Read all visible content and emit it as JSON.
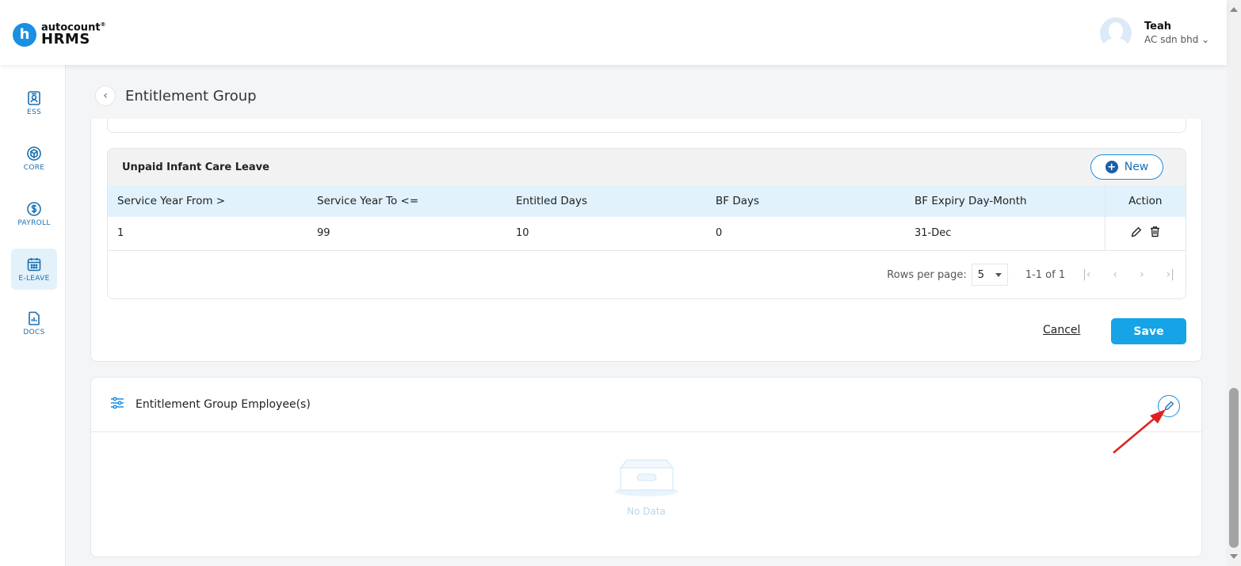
{
  "app": {
    "logo_letter": "h",
    "logo_top": "autocount",
    "logo_mark": "®",
    "logo_bottom": "HRMS",
    "brand_color": "#1a8fe3"
  },
  "user": {
    "name": "Teah",
    "company": "AC sdn bhd"
  },
  "sidebar": {
    "items": [
      {
        "label": "ESS",
        "icon": "ess-icon",
        "active": false
      },
      {
        "label": "CORE",
        "icon": "core-icon",
        "active": false
      },
      {
        "label": "PAYROLL",
        "icon": "payroll-icon",
        "active": false
      },
      {
        "label": "E-LEAVE",
        "icon": "calendar-icon",
        "active": true
      },
      {
        "label": "DOCS",
        "icon": "docs-icon",
        "active": false
      }
    ]
  },
  "page": {
    "title": "Entitlement Group"
  },
  "leave_section": {
    "title": "Unpaid Infant Care Leave",
    "new_label": "New",
    "columns": [
      "Service Year From >",
      "Service Year To <=",
      "Entitled Days",
      "BF Days",
      "BF Expiry Day-Month",
      "Action"
    ],
    "rows": [
      {
        "from": "1",
        "to": "99",
        "entitled": "10",
        "bf": "0",
        "expiry": "31-Dec"
      }
    ],
    "pagination": {
      "rows_per_page_label": "Rows per page:",
      "rows_per_page": "5",
      "range": "1-1 of 1"
    }
  },
  "actions": {
    "cancel_label": "Cancel",
    "save_label": "Save",
    "save_color": "#16a4e6"
  },
  "employees_section": {
    "title": "Entitlement Group Employee(s)",
    "empty_label": "No Data"
  },
  "annotation": {
    "arrow_color": "#e02020"
  }
}
